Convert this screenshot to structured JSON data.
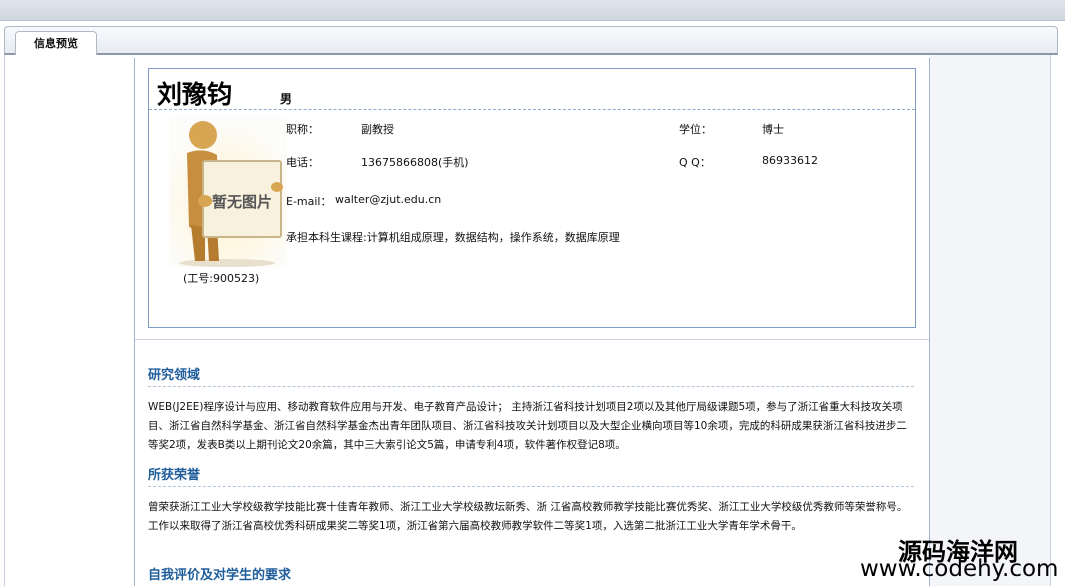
{
  "tab": {
    "label": "信息预览"
  },
  "profile": {
    "name": "刘豫钧",
    "gender": "男",
    "photo_placeholder": "暂无图片",
    "employee_id": "(工号:900523)",
    "fields": {
      "title_label": "职称：",
      "title_value": "副教授",
      "degree_label": "学位：",
      "degree_value": "博士",
      "phone_label": "电话：",
      "phone_value": "13675866808(手机)",
      "qq_label": "Q Q：",
      "qq_value": "86933612",
      "email_label": "E-mail：",
      "email_value": "walter@zjut.edu.cn",
      "courses": "承担本科生课程:计算机组成原理，数据结构，操作系统，数据库原理"
    }
  },
  "sections": {
    "research": {
      "heading": "研究领域",
      "text": "WEB(J2EE)程序设计与应用、移动教育软件应用与开发、电子教育产品设计； 主持浙江省科技计划项目2项以及其他厅局级课题5项，参与了浙江省重大科技攻关项目、浙江省自然科学基金、浙江省自然科学基金杰出青年团队项目、浙江省科技攻关计划项目以及大型企业横向项目等10余项，完成的科研成果获浙江省科技进步二等奖2项，发表B类以上期刊论文20余篇，其中三大索引论文5篇，申请专利4项，软件著作权登记8项。"
    },
    "honors": {
      "heading": "所获荣誉",
      "text": "曾荣获浙江工业大学校级教学技能比赛十佳青年教师、浙江工业大学校级教坛新秀、浙 江省高校教师教学技能比赛优秀奖、浙江工业大学校级优秀教师等荣誉称号。 工作以来取得了浙江省高校优秀科研成果奖二等奖1项，浙江省第六届高校教师教学软件二等奖1项，入选第二批浙江工业大学青年学术骨干。"
    },
    "self_eval": {
      "heading": "自我评价及对学生的要求"
    }
  },
  "watermark": {
    "line1": "源码海洋网",
    "line2": "www.codehy.com"
  },
  "colors": {
    "heading": "#1f5d9b",
    "card_border": "#7f9cc5"
  }
}
